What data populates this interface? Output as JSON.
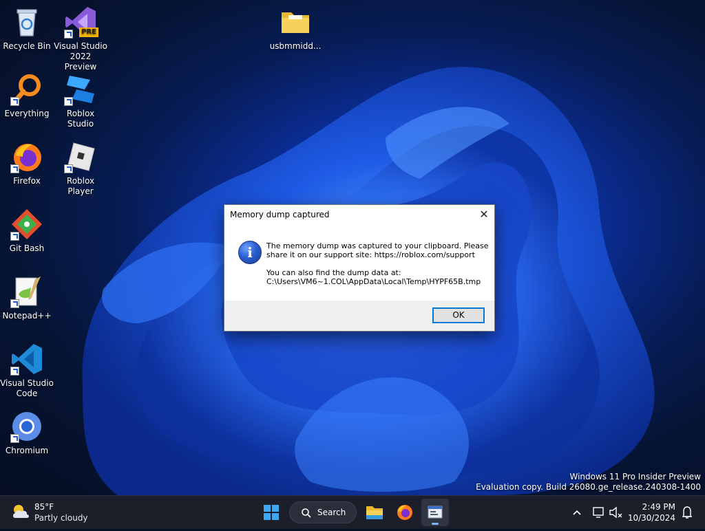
{
  "desktop": {
    "icons": [
      {
        "label": "Recycle Bin"
      },
      {
        "label": "Visual Studio 2022 Preview",
        "badge": "PRE"
      },
      {
        "label": "usbmmidd..."
      },
      {
        "label": "Everything"
      },
      {
        "label": "Roblox Studio"
      },
      {
        "label": "Firefox"
      },
      {
        "label": "Roblox Player"
      },
      {
        "label": "Git Bash"
      },
      {
        "label": "Notepad++"
      },
      {
        "label": "Visual Studio Code"
      },
      {
        "label": "Chromium"
      }
    ]
  },
  "dialog": {
    "title": "Memory dump captured",
    "close_glyph": "✕",
    "message_line1": "The memory dump was captured to your clipboard. Please",
    "message_line2": "share it on our support site: https://roblox.com/support",
    "message_line3": "You can also find the dump data at:",
    "message_line4": "C:\\Users\\VM6~1.COL\\AppData\\Local\\Temp\\HYPF65B.tmp",
    "ok_label": "OK",
    "icon": "info-icon"
  },
  "watermark": {
    "line1": "Windows 11 Pro Insider Preview",
    "line2": "Evaluation copy. Build 26080.ge_release.240308-1400"
  },
  "taskbar": {
    "weather_temp": "85°F",
    "weather_condition": "Partly cloudy",
    "search_label": "Search",
    "pinned": [
      "start-button",
      "search",
      "file-explorer",
      "firefox",
      "active-app"
    ],
    "clock_time": "2:49 PM",
    "clock_date": "10/30/2024"
  },
  "colors": {
    "taskbar_bg": "#1c1f2a",
    "accent": "#0078d7",
    "wallpaper_blue": "#1a4fd6"
  }
}
